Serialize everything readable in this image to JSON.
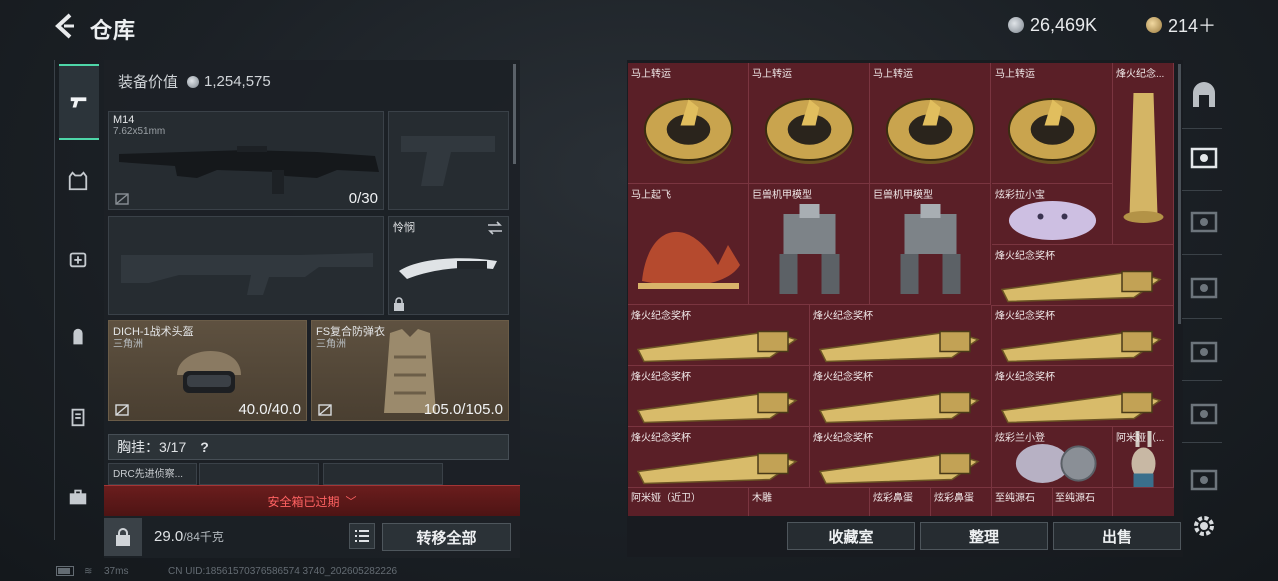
{
  "header": {
    "title": "仓库",
    "currency_1": "26,469K",
    "currency_2": "214＋"
  },
  "left_panel": {
    "value_label": "装备价值",
    "value_amount": "1,254,575",
    "primary_weapon": {
      "name": "M14",
      "caliber": "7.62x51mm",
      "ammo": "0/30"
    },
    "melee": {
      "name": "怜悯"
    },
    "helmet": {
      "name": "DICH-1战术头盔",
      "origin": "三角洲",
      "durability": "40.0/40.0"
    },
    "armor": {
      "name": "FS复合防弹衣",
      "origin": "三角洲",
      "durability": "105.0/105.0"
    },
    "chest_rig": {
      "label": "胸挂：",
      "count": "3/17",
      "help": "?"
    },
    "small_item": "DRC先进侦察...",
    "safe_box": "安全箱已过期",
    "weight": {
      "value": "29.0",
      "capacity": "/84千克"
    },
    "transfer_all": "转移全部"
  },
  "stash": {
    "items": [
      {
        "name": "马上转运",
        "kind": "coin"
      },
      {
        "name": "马上转运",
        "kind": "coin"
      },
      {
        "name": "马上转运",
        "kind": "coin"
      },
      {
        "name": "马上转运",
        "kind": "coin"
      },
      {
        "name": "烽火纪念...",
        "kind": "tall-trophy"
      },
      {
        "name": "马上起飞",
        "kind": "horse"
      },
      {
        "name": "巨兽机甲模型",
        "kind": "mech"
      },
      {
        "name": "巨兽机甲模型",
        "kind": "mech"
      },
      {
        "name": "炫彩拉小宝",
        "kind": "plush"
      },
      {
        "name": "烽火纪念奖杯",
        "kind": "trophy"
      },
      {
        "name": "烽火纪念奖杯",
        "kind": "trophy"
      },
      {
        "name": "烽火纪念奖杯",
        "kind": "trophy"
      },
      {
        "name": "烽火纪念奖杯",
        "kind": "trophy"
      },
      {
        "name": "烽火纪念奖杯",
        "kind": "trophy"
      },
      {
        "name": "烽火纪念奖杯",
        "kind": "trophy"
      },
      {
        "name": "烽火纪念奖杯",
        "kind": "trophy"
      },
      {
        "name": "烽火纪念奖杯",
        "kind": "trophy"
      },
      {
        "name": "烽火纪念奖杯",
        "kind": "trophy"
      },
      {
        "name": "炫彩兰小登",
        "kind": "plush2"
      },
      {
        "name": "阿米娅（...",
        "kind": "figure"
      },
      {
        "name": "阿米娅（近卫）",
        "kind": "partial"
      },
      {
        "name": "木雕",
        "kind": "partial"
      },
      {
        "name": "炫彩鼻蛋",
        "kind": "partial"
      },
      {
        "name": "炫彩鼻蛋",
        "kind": "partial"
      },
      {
        "name": "至纯源石",
        "kind": "partial"
      },
      {
        "name": "至纯源石",
        "kind": "partial"
      }
    ],
    "buttons": {
      "collection": "收藏室",
      "organize": "整理",
      "sell": "出售"
    }
  },
  "status_bar": {
    "ping": "37ms",
    "uid": "CN UID:18561570376586574 3740_202605282226"
  },
  "colors": {
    "accent": "#4ed6a8",
    "warning": "#ff6262",
    "stash_bg": "#5a1f27"
  }
}
